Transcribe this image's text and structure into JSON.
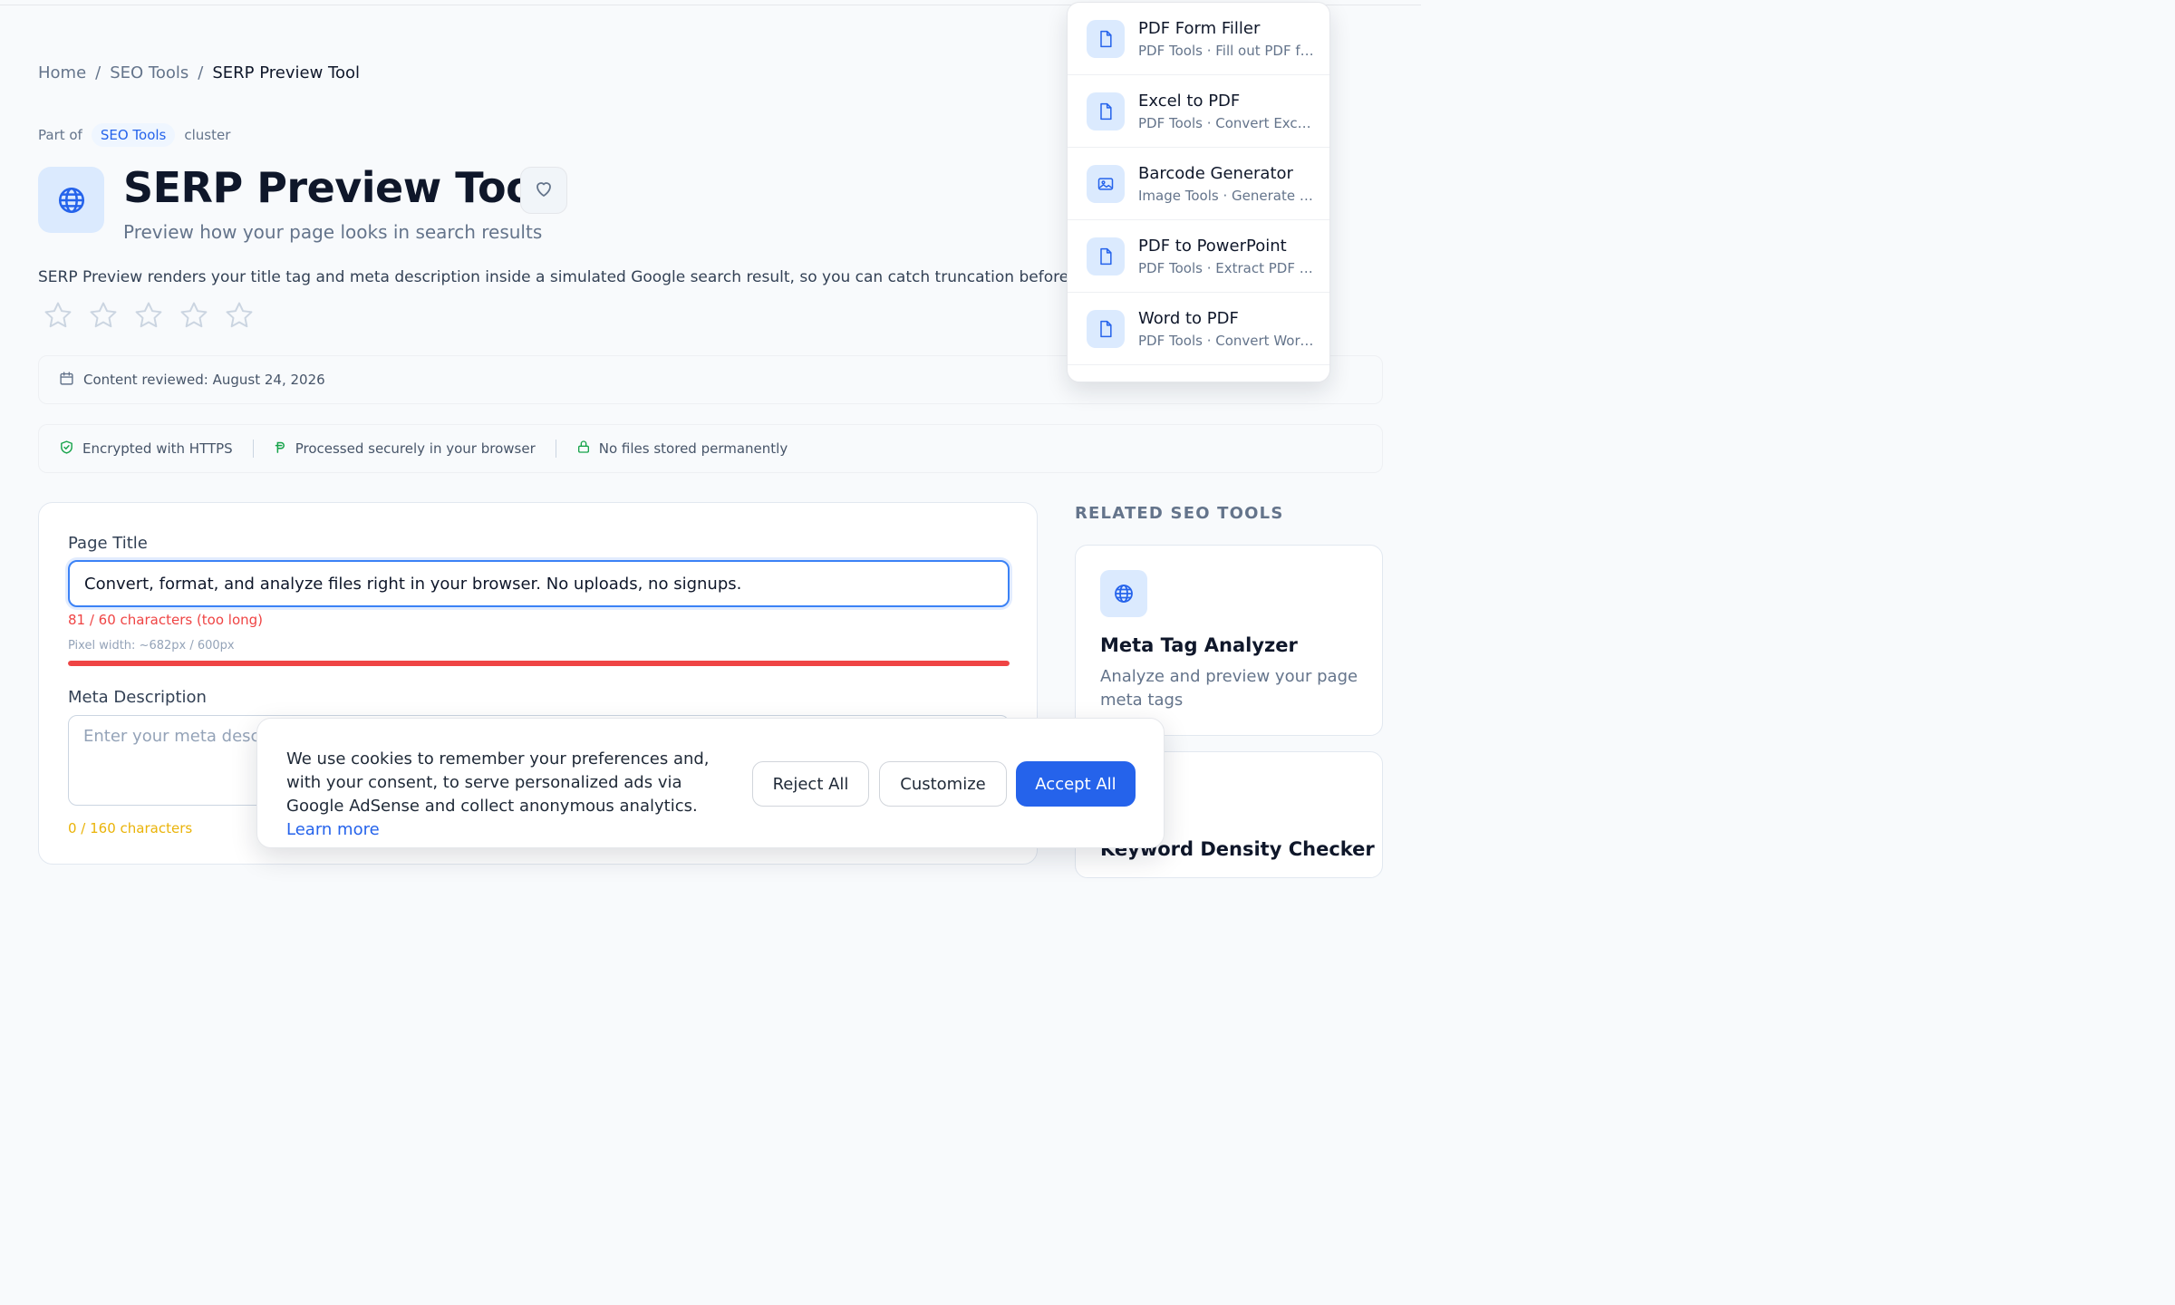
{
  "breadcrumb": {
    "home": "Home",
    "sep1": "/",
    "section": "SEO Tools",
    "sep2": "/",
    "current": "SERP Preview Tool"
  },
  "cluster": {
    "prefix": "Part of",
    "name": "SEO Tools",
    "suffix": "cluster"
  },
  "tool": {
    "title": "SERP Preview Tool",
    "subtitle": "Preview how your page looks in search results",
    "description": "SERP Preview renders your title tag and meta description inside a simulated Google search result, so you can catch truncation before publishing.",
    "rating_out_of": 5
  },
  "reviewed": "Content reviewed: August 24, 2026",
  "trust": [
    "Encrypted with HTTPS",
    "Processed securely in your browser",
    "No files stored permanently"
  ],
  "form": {
    "title_label": "Page Title",
    "title_value": "Convert, format, and analyze files right in your browser. No uploads, no signups.",
    "title_count": "81 / 60 characters (too long)",
    "pixel_width": "Pixel width: ~682px / 600px",
    "pixel_fill": 1.0,
    "meta_label": "Meta Description",
    "meta_placeholder": "Enter your meta description...",
    "meta_count": "0 / 160 characters"
  },
  "related": {
    "heading": "RELATED SEO TOOLS",
    "items": [
      {
        "name": "Meta Tag Analyzer",
        "desc": "Analyze and preview your page meta tags",
        "icon": "globe-icon"
      },
      {
        "name": "Keyword Density Checker",
        "desc": "",
        "icon": ""
      }
    ]
  },
  "dropdown": {
    "items": [
      {
        "name": "PDF Form Filler",
        "sub": "PDF Tools · Fill out PDF forms",
        "icon": "file-icon"
      },
      {
        "name": "Excel to PDF",
        "sub": "PDF Tools · Convert Excel to PDF",
        "icon": "file-icon"
      },
      {
        "name": "Barcode Generator",
        "sub": "Image Tools · Generate barcodes",
        "icon": "image-icon"
      },
      {
        "name": "PDF to PowerPoint",
        "sub": "PDF Tools · Extract PDF to slides",
        "icon": "file-icon"
      },
      {
        "name": "Word to PDF",
        "sub": "PDF Tools · Convert Word to PDF",
        "icon": "file-icon"
      }
    ]
  },
  "cookie": {
    "text": "We use cookies to remember your preferences and, with your consent, to serve personalized ads via Google AdSense and collect anonymous analytics.",
    "learn_more": "Learn more",
    "reject": "Reject All",
    "customize": "Customize",
    "accept": "Accept All"
  },
  "colors": {
    "accent": "#2563eb",
    "danger": "#ef4444",
    "warning": "#eab308",
    "success": "#16a34a"
  }
}
